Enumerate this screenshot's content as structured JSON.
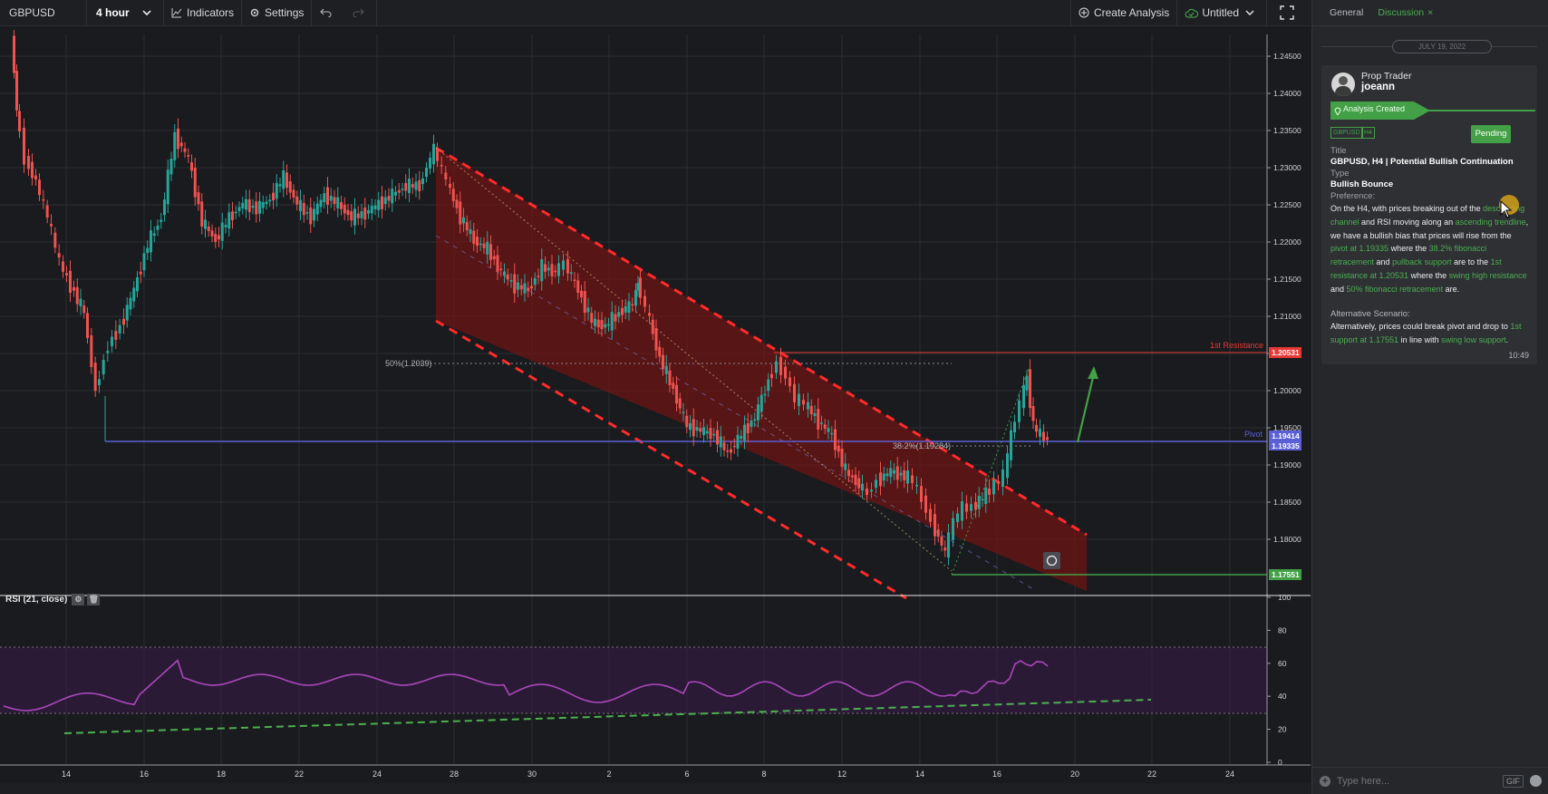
{
  "toolbar": {
    "symbol": "GBPUSD",
    "interval": "4 hour",
    "indicators_label": "Indicators",
    "settings_label": "Settings",
    "create_analysis_label": "Create Analysis",
    "layout_name": "Untitled"
  },
  "colors": {
    "bull": "#26a69a",
    "bear": "#ef5350",
    "channel": "#ff2b2b",
    "rsi": "#ab47bc",
    "accent": "#4caf50",
    "pivot": "#5b5fd6"
  },
  "chart_data": {
    "type": "candlestick",
    "symbol": "GBPUSD",
    "timeframe": "H4",
    "y_ticks": [
      "1.24500",
      "1.24000",
      "1.23500",
      "1.23000",
      "1.22500",
      "1.22000",
      "1.21500",
      "1.21000",
      "1.20500",
      "1.20000",
      "1.19500",
      "1.19000",
      "1.18500",
      "1.18000"
    ],
    "x_ticks": [
      "14",
      "16",
      "18",
      "22",
      "24",
      "28",
      "30",
      "2",
      "6",
      "8",
      "12",
      "14",
      "16",
      "20",
      "22",
      "24"
    ],
    "levels": {
      "resistance": {
        "label": "1st Resistance",
        "value": "1.20531"
      },
      "pivot": {
        "label": "Pivot",
        "value": "1.19335"
      },
      "last_price": "1.19414",
      "support": {
        "value": "1.17551"
      }
    },
    "fib_labels": [
      "50%(1.2039)",
      "38.2%(1.19284)"
    ],
    "rsi": {
      "label": "RSI (21, close)",
      "y_ticks": [
        "100",
        "80",
        "60",
        "40",
        "20",
        "0"
      ],
      "overbought": 70,
      "oversold": 30
    }
  },
  "panel": {
    "tabs": [
      "General",
      "Discussion"
    ],
    "close_icon": "×",
    "date": "JULY 19, 2022",
    "role": "Prop Trader",
    "username": "joeann",
    "status": "Analysis Created",
    "tags": [
      "GBPUSD",
      "H4"
    ],
    "pending": "Pending",
    "title_label": "Title",
    "title_value": "GBPUSD, H4 | Potential Bullish Continuation",
    "type_label": "Type",
    "type_value": "Bullish Bounce",
    "pref_label": "Preference:",
    "pref": {
      "t1": "On the H4, with prices breaking out of the ",
      "g1": "descending channel",
      "t2": " and RSI moving along an ",
      "g2": "ascending trendline",
      "t3": ", we have a bullish bias that prices will rise from the ",
      "g3": "pivot at 1.19335",
      "t4": " where the ",
      "g4": "38.2% fibonacci retracement",
      "t5": " and ",
      "g5": "pullback support",
      "t6": " are to the ",
      "g6": "1st resistance at 1.20531",
      "t7": " where the ",
      "g7": "swing high resistance",
      "t8": " and ",
      "g8": "50% fibonacci retracement",
      "t9": " are."
    },
    "alt_label": "Alternative Scenario:",
    "alt": {
      "t1": "Alternatively, prices could break pivot and drop to ",
      "g1": "1st support at 1.17551",
      "t2": " in line with ",
      "g2": "swing low support",
      "t3": "."
    },
    "time": "10:49",
    "input_placeholder": "Type here...",
    "gif_label": "GIF"
  }
}
